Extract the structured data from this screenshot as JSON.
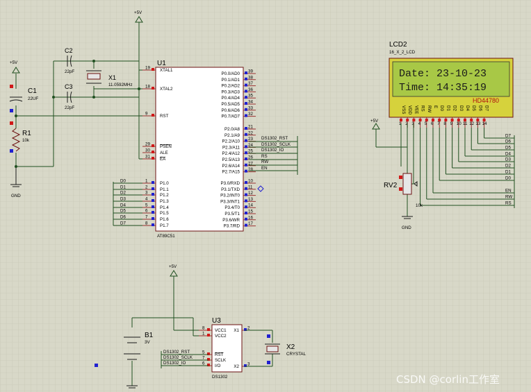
{
  "power_labels": {
    "vcc_top": "+5V",
    "vcc_left": "+5V",
    "vcc_lcd": "+5V",
    "vcc_rtc": "+5V",
    "gnd_left": "GND",
    "gnd_lcd": "GND"
  },
  "components": {
    "c1": {
      "ref": "C1",
      "value": "22UF"
    },
    "c2": {
      "ref": "C2",
      "value": "22pF"
    },
    "c3": {
      "ref": "C3",
      "value": "22pF"
    },
    "x1": {
      "ref": "X1",
      "value": "11.0592MHz"
    },
    "r1": {
      "ref": "R1",
      "value": "10k"
    },
    "u1": {
      "ref": "U1",
      "part": "AT89C51"
    },
    "u3": {
      "ref": "U3",
      "part": "DS1302"
    },
    "x2": {
      "ref": "X2",
      "value": "CRYSTAL"
    },
    "b1": {
      "ref": "B1",
      "value": "3V"
    },
    "rv2": {
      "ref": "RV2",
      "value": "10k"
    },
    "lcd2": {
      "ref": "LCD2",
      "part": "16_X_2_LCD",
      "model": "HD44780"
    }
  },
  "u1_left_pins": [
    {
      "num": "19",
      "name": "XTAL1"
    },
    {
      "num": "18",
      "name": "XTAL2"
    },
    {
      "num": "9",
      "name": "RST"
    },
    {
      "num": "29",
      "name": "PSEN"
    },
    {
      "num": "30",
      "name": "ALE"
    },
    {
      "num": "31",
      "name": "EA"
    },
    {
      "num": "1",
      "name": "P1.0",
      "net": "D0"
    },
    {
      "num": "2",
      "name": "P1.1",
      "net": "D1"
    },
    {
      "num": "3",
      "name": "P1.2",
      "net": "D2"
    },
    {
      "num": "4",
      "name": "P1.3",
      "net": "D3"
    },
    {
      "num": "5",
      "name": "P1.4",
      "net": "D4"
    },
    {
      "num": "6",
      "name": "P1.5",
      "net": "D5"
    },
    {
      "num": "7",
      "name": "P1.6",
      "net": "D6"
    },
    {
      "num": "8",
      "name": "P1.7",
      "net": "D7"
    }
  ],
  "u1_right_pins": [
    {
      "num": "39",
      "name": "P0.0/AD0"
    },
    {
      "num": "38",
      "name": "P0.1/AD1"
    },
    {
      "num": "37",
      "name": "P0.2/AD2"
    },
    {
      "num": "36",
      "name": "P0.3/AD3"
    },
    {
      "num": "35",
      "name": "P0.4/AD4"
    },
    {
      "num": "34",
      "name": "P0.5/AD5"
    },
    {
      "num": "33",
      "name": "P0.6/AD6"
    },
    {
      "num": "32",
      "name": "P0.7/AD7"
    },
    {
      "num": "21",
      "name": "P2.0/A8"
    },
    {
      "num": "22",
      "name": "P2.1/A9"
    },
    {
      "num": "23",
      "name": "P2.2/A10",
      "net": "DS1302_RST"
    },
    {
      "num": "24",
      "name": "P2.3/A11",
      "net": "DS1302_SCLK"
    },
    {
      "num": "25",
      "name": "P2.4/A12",
      "net": "DS1302_IO"
    },
    {
      "num": "26",
      "name": "P2.5/A13",
      "net": "RS"
    },
    {
      "num": "27",
      "name": "P2.6/A14",
      "net": "RW"
    },
    {
      "num": "28",
      "name": "P2.7/A15",
      "net": "EN"
    },
    {
      "num": "10",
      "name": "P3.0/RXD"
    },
    {
      "num": "11",
      "name": "P3.1/TXD"
    },
    {
      "num": "12",
      "name": "P3.2/INT0"
    },
    {
      "num": "13",
      "name": "P3.3/INT1"
    },
    {
      "num": "14",
      "name": "P3.4/T0"
    },
    {
      "num": "15",
      "name": "P3.5/T1"
    },
    {
      "num": "16",
      "name": "P3.6/WR"
    },
    {
      "num": "17",
      "name": "P3.7/RD"
    }
  ],
  "u3_pins": [
    {
      "num": "8",
      "name": "VCC1"
    },
    {
      "num": "1",
      "name": "VCC2"
    },
    {
      "num": "2",
      "name": "X1"
    },
    {
      "num": "5",
      "name": "RST",
      "net": "DS1302_RST"
    },
    {
      "num": "7",
      "name": "SCLK",
      "net": "DS1302_SCLK"
    },
    {
      "num": "6",
      "name": "I/O",
      "net": "DS1302_IO"
    },
    {
      "num": "3",
      "name": "X2"
    }
  ],
  "lcd_pins": [
    "VSS",
    "VDD",
    "VEE",
    "RS",
    "RW",
    "E",
    "D0",
    "D1",
    "D2",
    "D3",
    "D4",
    "D5",
    "D6",
    "D7"
  ],
  "lcd_pin_nums": [
    "1",
    "2",
    "3",
    "4",
    "5",
    "6",
    "7",
    "8",
    "9",
    "10",
    "11",
    "12",
    "13",
    "14"
  ],
  "lcd_bus_labels": [
    "D7",
    "D6",
    "D5",
    "D4",
    "D3",
    "D2",
    "D1",
    "D0",
    "EN",
    "RW",
    "RS"
  ],
  "lcd_display": {
    "line1": "Date: 23-10-23",
    "line2": "Time: 14:35:19"
  },
  "watermark": "CSDN @corlin工作室",
  "colors": {
    "background": "#d8d8c8",
    "grid": "#c2c2b0",
    "wire": "#1f4f1f",
    "component_outline": "#6b1010",
    "lcd_screen": "#a8c846",
    "lcd_bezel": "#d6d23c"
  }
}
